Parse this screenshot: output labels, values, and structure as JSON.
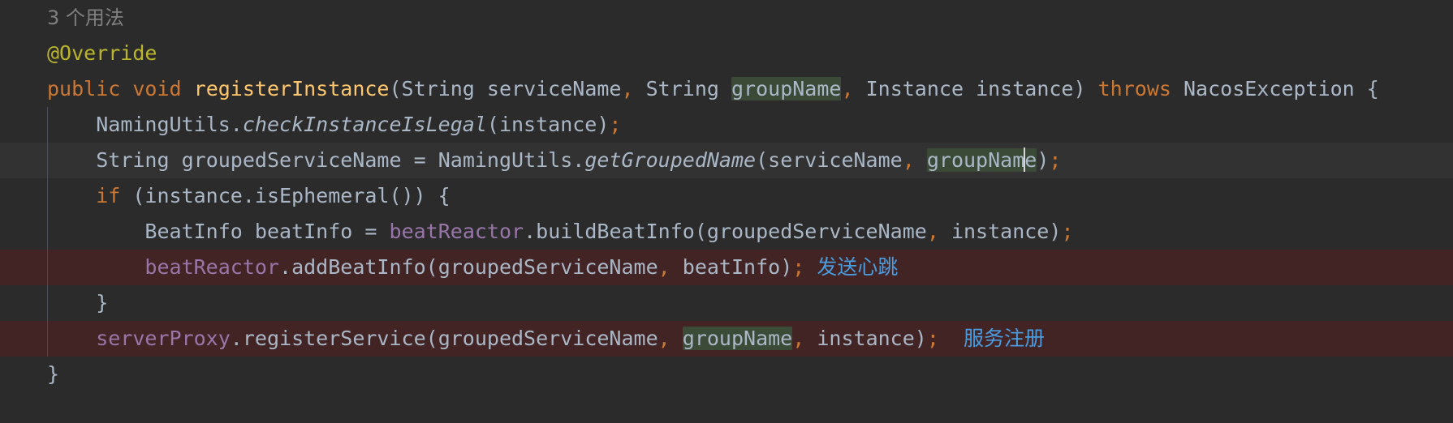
{
  "editor": {
    "theme": "darcula",
    "background_color": "#2b2b2b",
    "caret_line_color": "#323232",
    "error_line_color": "#432424",
    "occurrence_highlight_color": "#3a4a37",
    "caret_color": "#d8d8d8",
    "colors": {
      "keyword": "#cc7832",
      "annotation": "#bbb529",
      "method_declaration": "#ffc66d",
      "identifier": "#a9b7c6",
      "field": "#9876aa",
      "hint": "#808080",
      "cjk_annotation": "#4a9ce0"
    }
  },
  "usages_hint": "3 个用法",
  "code": {
    "annotation_line": "@Override",
    "signature": {
      "modifier": "public",
      "return_type": "void",
      "method_name": "registerInstance",
      "open_paren": "(",
      "param1_type": "String",
      "param1_name": "serviceName",
      "comma1": ",",
      "param2_type": "String",
      "param2_name": "groupName",
      "comma2": ",",
      "param3_type": "Instance",
      "param3_name": "instance",
      "close_paren": ")",
      "throws_keyword": "throws",
      "exception_type": "NacosException",
      "open_brace": "{"
    },
    "line_check": {
      "receiver": "NamingUtils",
      "dot": ".",
      "method": "checkInstanceIsLegal",
      "args": "(instance)",
      "semicolon": ";"
    },
    "line_grouped": {
      "type": "String",
      "var": "groupedServiceName",
      "assign": "=",
      "receiver": "NamingUtils",
      "dot": ".",
      "method": "getGroupedName",
      "open_paren": "(",
      "arg1": "serviceName",
      "comma": ",",
      "arg2_before_caret": "groupNam",
      "arg2_after_caret": "e",
      "close_paren": ")",
      "semicolon": ";"
    },
    "line_if": {
      "keyword": "if",
      "condition": " (instance.isEphemeral()) ",
      "open_brace": "{"
    },
    "line_beatinfo": {
      "type": "BeatInfo",
      "var": "beatInfo",
      "assign": "=",
      "field": "beatReactor",
      "dot": ".",
      "method": "buildBeatInfo",
      "open_paren": "(",
      "arg1": "groupedServiceName",
      "comma": ",",
      "arg2": "instance",
      "close_paren": ")",
      "semicolon": ";"
    },
    "line_addbeat": {
      "field": "beatReactor",
      "dot": ".",
      "method": "addBeatInfo",
      "open_paren": "(",
      "arg1": "groupedServiceName",
      "comma": ",",
      "arg2": "beatInfo",
      "close_paren": ")",
      "semicolon": ";",
      "cjk_note": "发送心跳"
    },
    "line_close_if": "}",
    "line_register": {
      "field": "serverProxy",
      "dot": ".",
      "method": "registerService",
      "open_paren": "(",
      "arg1": "groupedServiceName",
      "comma1": ",",
      "arg2": "groupName",
      "comma2": ",",
      "arg3": "instance",
      "close_paren": ")",
      "semicolon": ";",
      "cjk_note": "服务注册"
    },
    "line_close_method": "}"
  }
}
